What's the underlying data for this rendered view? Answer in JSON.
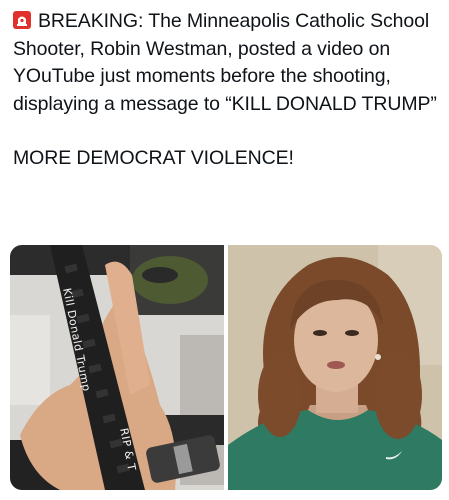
{
  "post": {
    "icon": "police-siren-icon",
    "paragraph_1": "BREAKING: The Minneapolis Catholic School Shooter, Robin Westman, posted a video on YOuTube just moments before the shooting, displaying a message to “KILL DONALD TRUMP”",
    "paragraph_2": "MORE DEMOCRAT VIOLENCE!"
  },
  "media": {
    "left_image": {
      "writing_line_1": "Kill Donald Trump",
      "writing_line_2": "RIP & T"
    },
    "right_image": {}
  },
  "colors": {
    "text": "#0f1419",
    "siren_red": "#e0312d",
    "shirt_green": "#2e7a62",
    "hair_brown": "#7a4a2a"
  }
}
